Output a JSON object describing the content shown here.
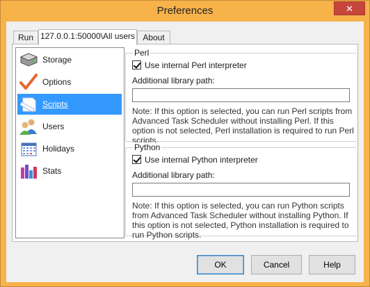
{
  "window": {
    "title": "Preferences",
    "close_glyph": "✕"
  },
  "tabs": [
    {
      "label": "Run",
      "active": false
    },
    {
      "label": "127.0.0.1:50000\\All users",
      "active": true
    },
    {
      "label": "About",
      "active": false
    }
  ],
  "nav": {
    "items": [
      {
        "label": "Storage",
        "icon": "storage-drive-icon",
        "selected": false
      },
      {
        "label": "Options",
        "icon": "checkmark-icon",
        "selected": false
      },
      {
        "label": "Scripts",
        "icon": "script-document-icon",
        "selected": true
      },
      {
        "label": "Users",
        "icon": "users-icon",
        "selected": false
      },
      {
        "label": "Holidays",
        "icon": "calendar-icon",
        "selected": false
      },
      {
        "label": "Stats",
        "icon": "bar-chart-icon",
        "selected": false
      }
    ]
  },
  "perl": {
    "legend": "Perl",
    "use_internal_label": "Use internal Perl interpreter",
    "use_internal_checked": true,
    "lib_path_label": "Additional library path:",
    "lib_path_value": "",
    "note": "Note: If this option is selected, you can run Perl scripts from Advanced Task Scheduler without installing Perl. If this option is not selected, Perl installation is required to run Perl scripts."
  },
  "python": {
    "legend": "Python",
    "use_internal_label": "Use internal Python interpreter",
    "use_internal_checked": true,
    "lib_path_label": "Additional library path:",
    "lib_path_value": "",
    "note": "Note: If this option is selected, you can run Python scripts from Advanced Task Scheduler without installing Python. If this option is not selected, Python installation is required to run Python scripts."
  },
  "buttons": {
    "ok": "OK",
    "cancel": "Cancel",
    "help": "Help"
  },
  "colors": {
    "title_bar": "#f7b24a",
    "close_button": "#c7463b",
    "selection": "#3399ff"
  }
}
